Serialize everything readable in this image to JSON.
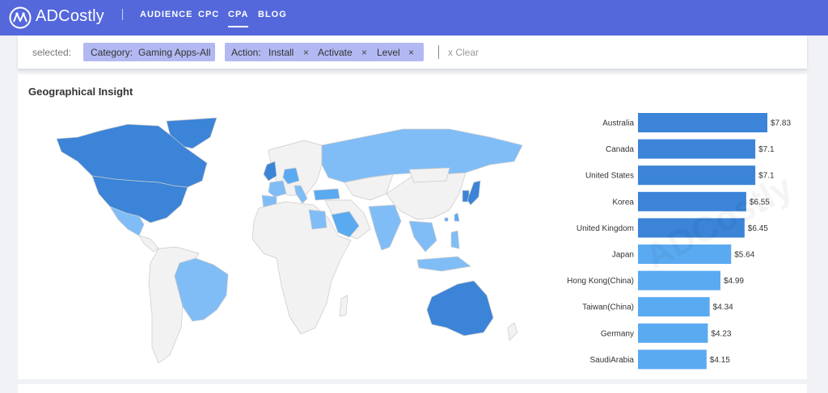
{
  "brand": {
    "name": "ADCostly"
  },
  "nav": {
    "items": [
      "AUDIENCE",
      "CPC",
      "CPA",
      "BLOG"
    ],
    "active": "CPA"
  },
  "filters": {
    "selected_label": "selected:",
    "category": {
      "key": "Category:",
      "value": "Gaming Apps-All"
    },
    "action": {
      "key": "Action:",
      "values": [
        "Install",
        "Activate",
        "Level"
      ]
    },
    "remove_glyph": "×",
    "clear_label": "x Clear"
  },
  "panel": {
    "title": "Geographical Insight"
  },
  "colors": {
    "nav_bg": "#5468dc",
    "chip_bg": "#b2b9f2",
    "bar_dark": "#3b84d8",
    "bar_light": "#5aaaf2",
    "map_dark": "#3b84d8",
    "map_light": "#80bdf7",
    "map_none": "#f2f2f2"
  },
  "chart_data": {
    "type": "bar",
    "orientation": "horizontal",
    "categories": [
      "Australia",
      "Canada",
      "United States",
      "Korea",
      "United Kingdom",
      "Japan",
      "Hong Kong(China)",
      "Taiwan(China)",
      "Germany",
      "SaudiArabia"
    ],
    "values": [
      7.83,
      7.1,
      7.1,
      6.55,
      6.45,
      5.64,
      4.99,
      4.34,
      4.23,
      4.15
    ],
    "value_labels": [
      "$7.83",
      "$7.1",
      "$7.1",
      "$6.55",
      "$6.45",
      "$5.64",
      "$4.99",
      "$4.34",
      "$4.23",
      "$4.15"
    ],
    "xlim": [
      0,
      7.83
    ],
    "title": "",
    "xlabel": "",
    "ylabel": ""
  },
  "watermark": "ADCostly"
}
